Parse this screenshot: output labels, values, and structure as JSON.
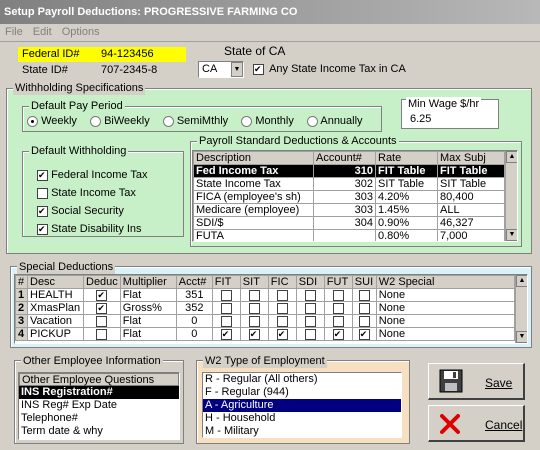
{
  "window": {
    "title": "Setup Payroll Deductions: PROGRESSIVE FARMING CO"
  },
  "menu": [
    "File",
    "Edit",
    "Options"
  ],
  "ids": {
    "federal_label": "Federal ID#",
    "federal_value": "94-123456",
    "state_label": "State ID#",
    "state_value": "707-2345-8"
  },
  "state": {
    "label": "State of CA",
    "selected": "CA",
    "any_tax_label": "Any State Income Tax in CA",
    "any_tax_checked": true
  },
  "withholding": {
    "title": "Withholding Specifications",
    "pay_period": {
      "title": "Default Pay Period",
      "options": [
        "Weekly",
        "BiWeekly",
        "SemiMthly",
        "Monthly",
        "Annually"
      ],
      "selected": "Weekly"
    },
    "min_wage": {
      "title": "Min Wage $/hr",
      "value": "6.25"
    },
    "default_withholding": {
      "title": "Default Withholding",
      "items": [
        {
          "label": "Federal Income Tax",
          "checked": true
        },
        {
          "label": "State Income Tax",
          "checked": false
        },
        {
          "label": "Social Security",
          "checked": true
        },
        {
          "label": "State Disability Ins",
          "checked": true
        }
      ]
    },
    "standard": {
      "title": "Payroll Standard Deductions & Accounts",
      "columns": [
        "Description",
        "Account#",
        "Rate",
        "Max Subj"
      ],
      "rows": [
        [
          "Fed Income Tax",
          "310",
          "FIT Table",
          "FIT Table"
        ],
        [
          "State Income Tax",
          "302",
          "SIT Table",
          "SIT Table"
        ],
        [
          "FICA (employee's sh)",
          "303",
          "4.20%",
          "80,400"
        ],
        [
          "Medicare (employee)",
          "303",
          "1.45%",
          "ALL"
        ],
        [
          "SDI/$",
          "304",
          "0.90%",
          "46,327"
        ],
        [
          "FUTA",
          "",
          "0.80%",
          "7,000"
        ]
      ]
    }
  },
  "special": {
    "title": "Special Deductions",
    "columns": [
      "#",
      "Desc",
      "Deduc",
      "Multiplier",
      "Acct#",
      "FIT",
      "SIT",
      "FIC",
      "SDI",
      "FUT",
      "SUI",
      "W2 Special"
    ],
    "rows": [
      {
        "num": "1",
        "desc": "HEALTH",
        "deduc": true,
        "mult": "Flat",
        "acct": "351",
        "fit": false,
        "sit": false,
        "fic": false,
        "sdi": false,
        "fut": false,
        "sui": false,
        "w2": "None"
      },
      {
        "num": "2",
        "desc": "XmasPlan",
        "deduc": true,
        "mult": "Gross%",
        "acct": "352",
        "fit": false,
        "sit": false,
        "fic": false,
        "sdi": false,
        "fut": false,
        "sui": false,
        "w2": "None"
      },
      {
        "num": "3",
        "desc": "Vacation",
        "deduc": false,
        "mult": "Flat",
        "acct": "0",
        "fit": false,
        "sit": false,
        "fic": false,
        "sdi": false,
        "fut": false,
        "sui": false,
        "w2": "None"
      },
      {
        "num": "4",
        "desc": "PICKUP",
        "deduc": false,
        "mult": "Flat",
        "acct": "0",
        "fit": true,
        "sit": true,
        "fic": true,
        "sdi": false,
        "fut": true,
        "sui": true,
        "w2": "None"
      }
    ]
  },
  "other_info": {
    "title": "Other Employee Information",
    "header": "Other Employee Questions",
    "items": [
      "INS Registration#",
      "INS Reg# Exp Date",
      "Telephone#",
      "Term date & why"
    ],
    "selected": 0
  },
  "w2": {
    "title": "W2 Type of Employment",
    "items": [
      "R - Regular (All others)",
      "F - Regular (944)",
      "A - Agriculture",
      "H - Household",
      "M - Military"
    ],
    "selected": 2
  },
  "buttons": {
    "save": "Save",
    "cancel": "Cancel"
  }
}
